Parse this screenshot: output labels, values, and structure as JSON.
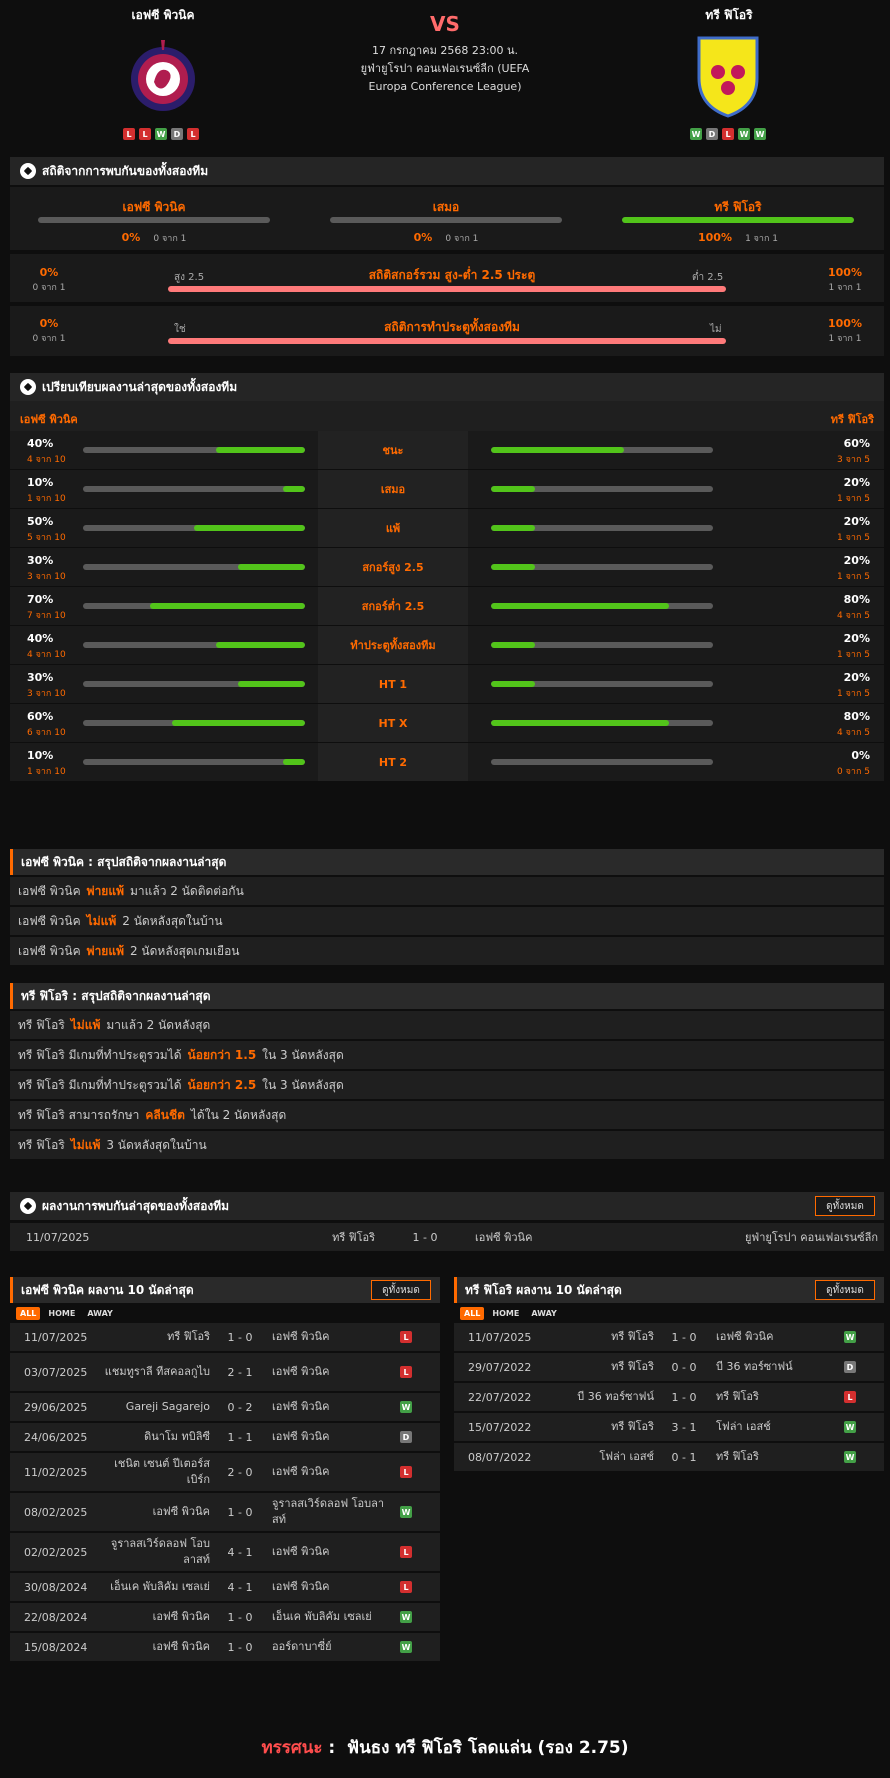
{
  "header": {
    "home_name": "เอฟซี พิวนิค",
    "away_name": "ทรี ฟิโอริ",
    "vs": "VS",
    "datetime": "17 กรกฎาคม 2568 23:00 น.",
    "competition": "ยูฟ่ายูโรปา คอนเฟอเรนซ์ลีก (UEFA Europa Conference League)",
    "home_form": [
      "L",
      "L",
      "W",
      "D",
      "L"
    ],
    "away_form": [
      "W",
      "D",
      "L",
      "W",
      "W"
    ],
    "home_logo_text": "PYUNIK YEREVAN",
    "away_logo_text": "TRE FIORI F.C. 1949"
  },
  "h2h_stats": {
    "title": "สถิติจากการพบกันของทั้งสองทีม",
    "home_label": "เอฟซี พิวนิค",
    "draw_label": "เสมอ",
    "away_label": "ทรี ฟิโอริ",
    "home_pct": "0%",
    "home_of": "0 จาก 1",
    "draw_pct": "0%",
    "draw_of": "0 จาก 1",
    "away_pct": "100%",
    "away_of": "1 จาก 1",
    "home_fill": 0,
    "draw_fill": 0,
    "away_fill": 1
  },
  "ou_stats": {
    "title": "สถิติสกอร์รวม สูง-ต่ำ 2.5 ประตู",
    "left_pct": "0%",
    "left_of": "0 จาก 1",
    "left_label": "สูง 2.5",
    "right_label": "ต่ำ 2.5",
    "right_pct": "100%",
    "right_of": "1 จาก 1"
  },
  "btts_stats": {
    "title": "สถิติการทำประตูทั้งสองทีม",
    "left_pct": "0%",
    "left_of": "0 จาก 1",
    "left_label": "ใช่",
    "right_label": "ไม่",
    "right_pct": "100%",
    "right_of": "1 จาก 1"
  },
  "comparison": {
    "title": "เปรียบเทียบผลงานล่าสุดของทั้งสองทีม",
    "home_label": "เอฟซี พิวนิค",
    "away_label": "ทรี ฟิโอริ",
    "rows": [
      {
        "label": "ชนะ",
        "hp": "40%",
        "hs": "4 จาก 10",
        "hf": 0.4,
        "ap": "60%",
        "as": "3 จาก 5",
        "af": 0.6
      },
      {
        "label": "เสมอ",
        "hp": "10%",
        "hs": "1 จาก 10",
        "hf": 0.1,
        "ap": "20%",
        "as": "1 จาก 5",
        "af": 0.2
      },
      {
        "label": "แพ้",
        "hp": "50%",
        "hs": "5 จาก 10",
        "hf": 0.5,
        "ap": "20%",
        "as": "1 จาก 5",
        "af": 0.2
      },
      {
        "label": "สกอร์สูง 2.5",
        "hp": "30%",
        "hs": "3 จาก 10",
        "hf": 0.3,
        "ap": "20%",
        "as": "1 จาก 5",
        "af": 0.2
      },
      {
        "label": "สกอร์ต่ำ 2.5",
        "hp": "70%",
        "hs": "7 จาก 10",
        "hf": 0.7,
        "ap": "80%",
        "as": "4 จาก 5",
        "af": 0.8
      },
      {
        "label": "ทำประตูทั้งสองทีม",
        "hp": "40%",
        "hs": "4 จาก 10",
        "hf": 0.4,
        "ap": "20%",
        "as": "1 จาก 5",
        "af": 0.2
      },
      {
        "label": "HT 1",
        "hp": "30%",
        "hs": "3 จาก 10",
        "hf": 0.3,
        "ap": "20%",
        "as": "1 จาก 5",
        "af": 0.2
      },
      {
        "label": "HT X",
        "hp": "60%",
        "hs": "6 จาก 10",
        "hf": 0.6,
        "ap": "80%",
        "as": "4 จาก 5",
        "af": 0.8
      },
      {
        "label": "HT 2",
        "hp": "10%",
        "hs": "1 จาก 10",
        "hf": 0.1,
        "ap": "0%",
        "as": "0 จาก 5",
        "af": 0
      }
    ]
  },
  "home_summary": {
    "title": "เอฟซี พิวนิค : สรุปสถิติจากผลงานล่าสุด",
    "rows": [
      {
        "a": "เอฟซี พิวนิค",
        "h": "พ่ายแพ้",
        "b": "มาแล้ว 2 นัดติดต่อกัน"
      },
      {
        "a": "เอฟซี พิวนิค",
        "h": "ไม่แพ้",
        "b": "2 นัดหลังสุดในบ้าน"
      },
      {
        "a": "เอฟซี พิวนิค",
        "h": "พ่ายแพ้",
        "b": "2 นัดหลังสุดเกมเยือน"
      }
    ]
  },
  "away_summary": {
    "title": "ทรี ฟิโอริ : สรุปสถิติจากผลงานล่าสุด",
    "rows": [
      {
        "a": "ทรี ฟิโอริ",
        "h": "ไม่แพ้",
        "b": "มาแล้ว 2 นัดหลังสุด"
      },
      {
        "a": "ทรี ฟิโอริ มีเกมที่ทำประตูรวมได้",
        "h": "น้อยกว่า 1.5",
        "b": "ใน 3 นัดหลังสุด"
      },
      {
        "a": "ทรี ฟิโอริ มีเกมที่ทำประตูรวมได้",
        "h": "น้อยกว่า 2.5",
        "b": "ใน 3 นัดหลังสุด"
      },
      {
        "a": "ทรี ฟิโอริ สามารถรักษา",
        "h": "คลีนชีต",
        "b": "ได้ใน 2 นัดหลังสุด"
      },
      {
        "a": "ทรี ฟิโอริ",
        "h": "ไม่แพ้",
        "b": "3 นัดหลังสุดในบ้าน"
      }
    ]
  },
  "h2h_results": {
    "title": "ผลงานการพบกันล่าสุดของทั้งสองทีม",
    "view_all": "ดูทั้งหมด",
    "rows": [
      {
        "date": "11/07/2025",
        "home": "ทรี ฟิโอริ",
        "score": "1 - 0",
        "away": "เอฟซี พิวนิค",
        "comp": "ยูฟ่ายูโรปา คอนเฟอเรนซ์ลีก"
      }
    ]
  },
  "home_last10": {
    "title": "เอฟซี พิวนิค ผลงาน 10 นัดล่าสุด",
    "view_all": "ดูทั้งหมด",
    "tabs": [
      "ALL",
      "HOME",
      "AWAY"
    ],
    "rows": [
      {
        "date": "11/07/2025",
        "home": "ทรี ฟิโอริ",
        "score": "1 - 0",
        "away": "เอฟซี พิวนิค",
        "r": "L"
      },
      {
        "date": "03/07/2025",
        "home": "แชมทูราลี ทีสคอลกูไบ",
        "score": "2 - 1",
        "away": "เอฟซี พิวนิค",
        "r": "L"
      },
      {
        "date": "29/06/2025",
        "home": "Gareji Sagarejo",
        "score": "0 - 2",
        "away": "เอฟซี พิวนิค",
        "r": "W"
      },
      {
        "date": "24/06/2025",
        "home": "ดินาโม ทบิลิซี",
        "score": "1 - 1",
        "away": "เอฟซี พิวนิค",
        "r": "D"
      },
      {
        "date": "11/02/2025",
        "home": "เชนิต เซนต์ ปีเตอร์สเบิร์ก",
        "score": "2 - 0",
        "away": "เอฟซี พิวนิค",
        "r": "L"
      },
      {
        "date": "08/02/2025",
        "home": "เอฟซี พิวนิค",
        "score": "1 - 0",
        "away": "จูราลสเวิร์ดลอฟ โอบลาสท์",
        "r": "W"
      },
      {
        "date": "02/02/2025",
        "home": "จูราลสเวิร์ดลอฟ โอบลาสท์",
        "score": "4 - 1",
        "away": "เอฟซี พิวนิค",
        "r": "L"
      },
      {
        "date": "30/08/2024",
        "home": "เอ็นเค พับลิคัม เซลเย่",
        "score": "4 - 1",
        "away": "เอฟซี พิวนิค",
        "r": "L"
      },
      {
        "date": "22/08/2024",
        "home": "เอฟซี พิวนิค",
        "score": "1 - 0",
        "away": "เอ็นเค พับลิคัม เซลเย่",
        "r": "W"
      },
      {
        "date": "15/08/2024",
        "home": "เอฟซี พิวนิค",
        "score": "1 - 0",
        "away": "ออร์ดาบาซี่ย์",
        "r": "W"
      }
    ]
  },
  "away_last10": {
    "title": "ทรี ฟิโอริ ผลงาน 10 นัดล่าสุด",
    "view_all": "ดูทั้งหมด",
    "tabs": [
      "ALL",
      "HOME",
      "AWAY"
    ],
    "rows": [
      {
        "date": "11/07/2025",
        "home": "ทรี ฟิโอริ",
        "score": "1 - 0",
        "away": "เอฟซี พิวนิค",
        "r": "W"
      },
      {
        "date": "29/07/2022",
        "home": "ทรี ฟิโอริ",
        "score": "0 - 0",
        "away": "บี 36 ทอร์ซาฟน์",
        "r": "D"
      },
      {
        "date": "22/07/2022",
        "home": "บี 36 ทอร์ซาฟน์",
        "score": "1 - 0",
        "away": "ทรี ฟิโอริ",
        "r": "L"
      },
      {
        "date": "15/07/2022",
        "home": "ทรี ฟิโอริ",
        "score": "3 - 1",
        "away": "โฟล่า เอสช์",
        "r": "W"
      },
      {
        "date": "08/07/2022",
        "home": "โฟล่า เอสช์",
        "score": "0 - 1",
        "away": "ทรี ฟิโอริ",
        "r": "W"
      }
    ]
  },
  "verdict": {
    "label": "ทรรศนะ",
    "sep": " :  ",
    "text": "ฟันธง ทรี ฟิโอริ โลดแล่น (รอง 2.75)"
  },
  "colors": {
    "accent": "#ff6a00",
    "green": "#52c41a",
    "red": "#ff6b6b",
    "win": "#43a047",
    "loss": "#d32f2f",
    "draw": "#777777"
  }
}
